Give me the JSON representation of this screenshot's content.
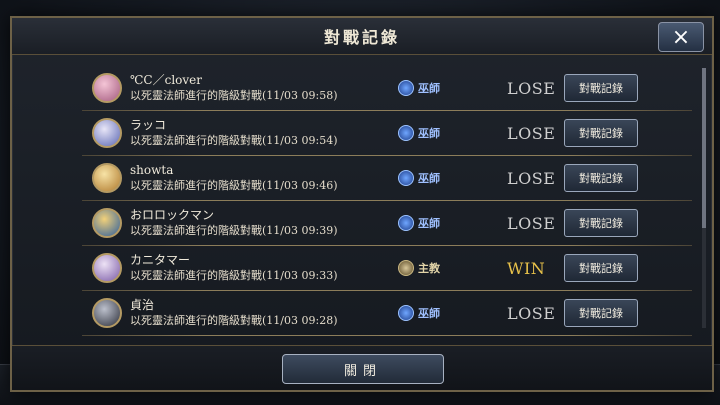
{
  "modal": {
    "title": "對戰記錄",
    "close_icon": "close-icon",
    "close_label": "×",
    "bottom_button": "關閉"
  },
  "records": [
    {
      "name": "℃C／clover",
      "desc": "以死靈法師進行的階級對戰(11/03 09:58)",
      "class_icon": "wizard-class-icon",
      "class_label": "巫師",
      "result": "LOSE",
      "button": "對戰記錄"
    },
    {
      "name": "ラッコ",
      "desc": "以死靈法師進行的階級對戰(11/03 09:54)",
      "class_icon": "wizard-class-icon",
      "class_label": "巫師",
      "result": "LOSE",
      "button": "對戰記錄"
    },
    {
      "name": "showta",
      "desc": "以死靈法師進行的階級對戰(11/03 09:46)",
      "class_icon": "wizard-class-icon",
      "class_label": "巫師",
      "result": "LOSE",
      "button": "對戰記錄"
    },
    {
      "name": "おロロックマン",
      "desc": "以死靈法師進行的階級對戰(11/03 09:39)",
      "class_icon": "wizard-class-icon",
      "class_label": "巫師",
      "result": "LOSE",
      "button": "對戰記錄"
    },
    {
      "name": "カニタマー",
      "desc": "以死靈法師進行的階級對戰(11/03 09:33)",
      "class_icon": "bishop-class-icon",
      "class_label": "主教",
      "result": "WIN",
      "button": "對戰記錄"
    },
    {
      "name": "貞治",
      "desc": "以死靈法師進行的階級對戰(11/03 09:28)",
      "class_icon": "wizard-class-icon",
      "class_label": "巫師",
      "result": "LOSE",
      "button": "對戰記錄"
    }
  ],
  "colors": {
    "win": "#e8c24a",
    "lose": "#cfcfcf",
    "accent_border": "#6d6147"
  }
}
